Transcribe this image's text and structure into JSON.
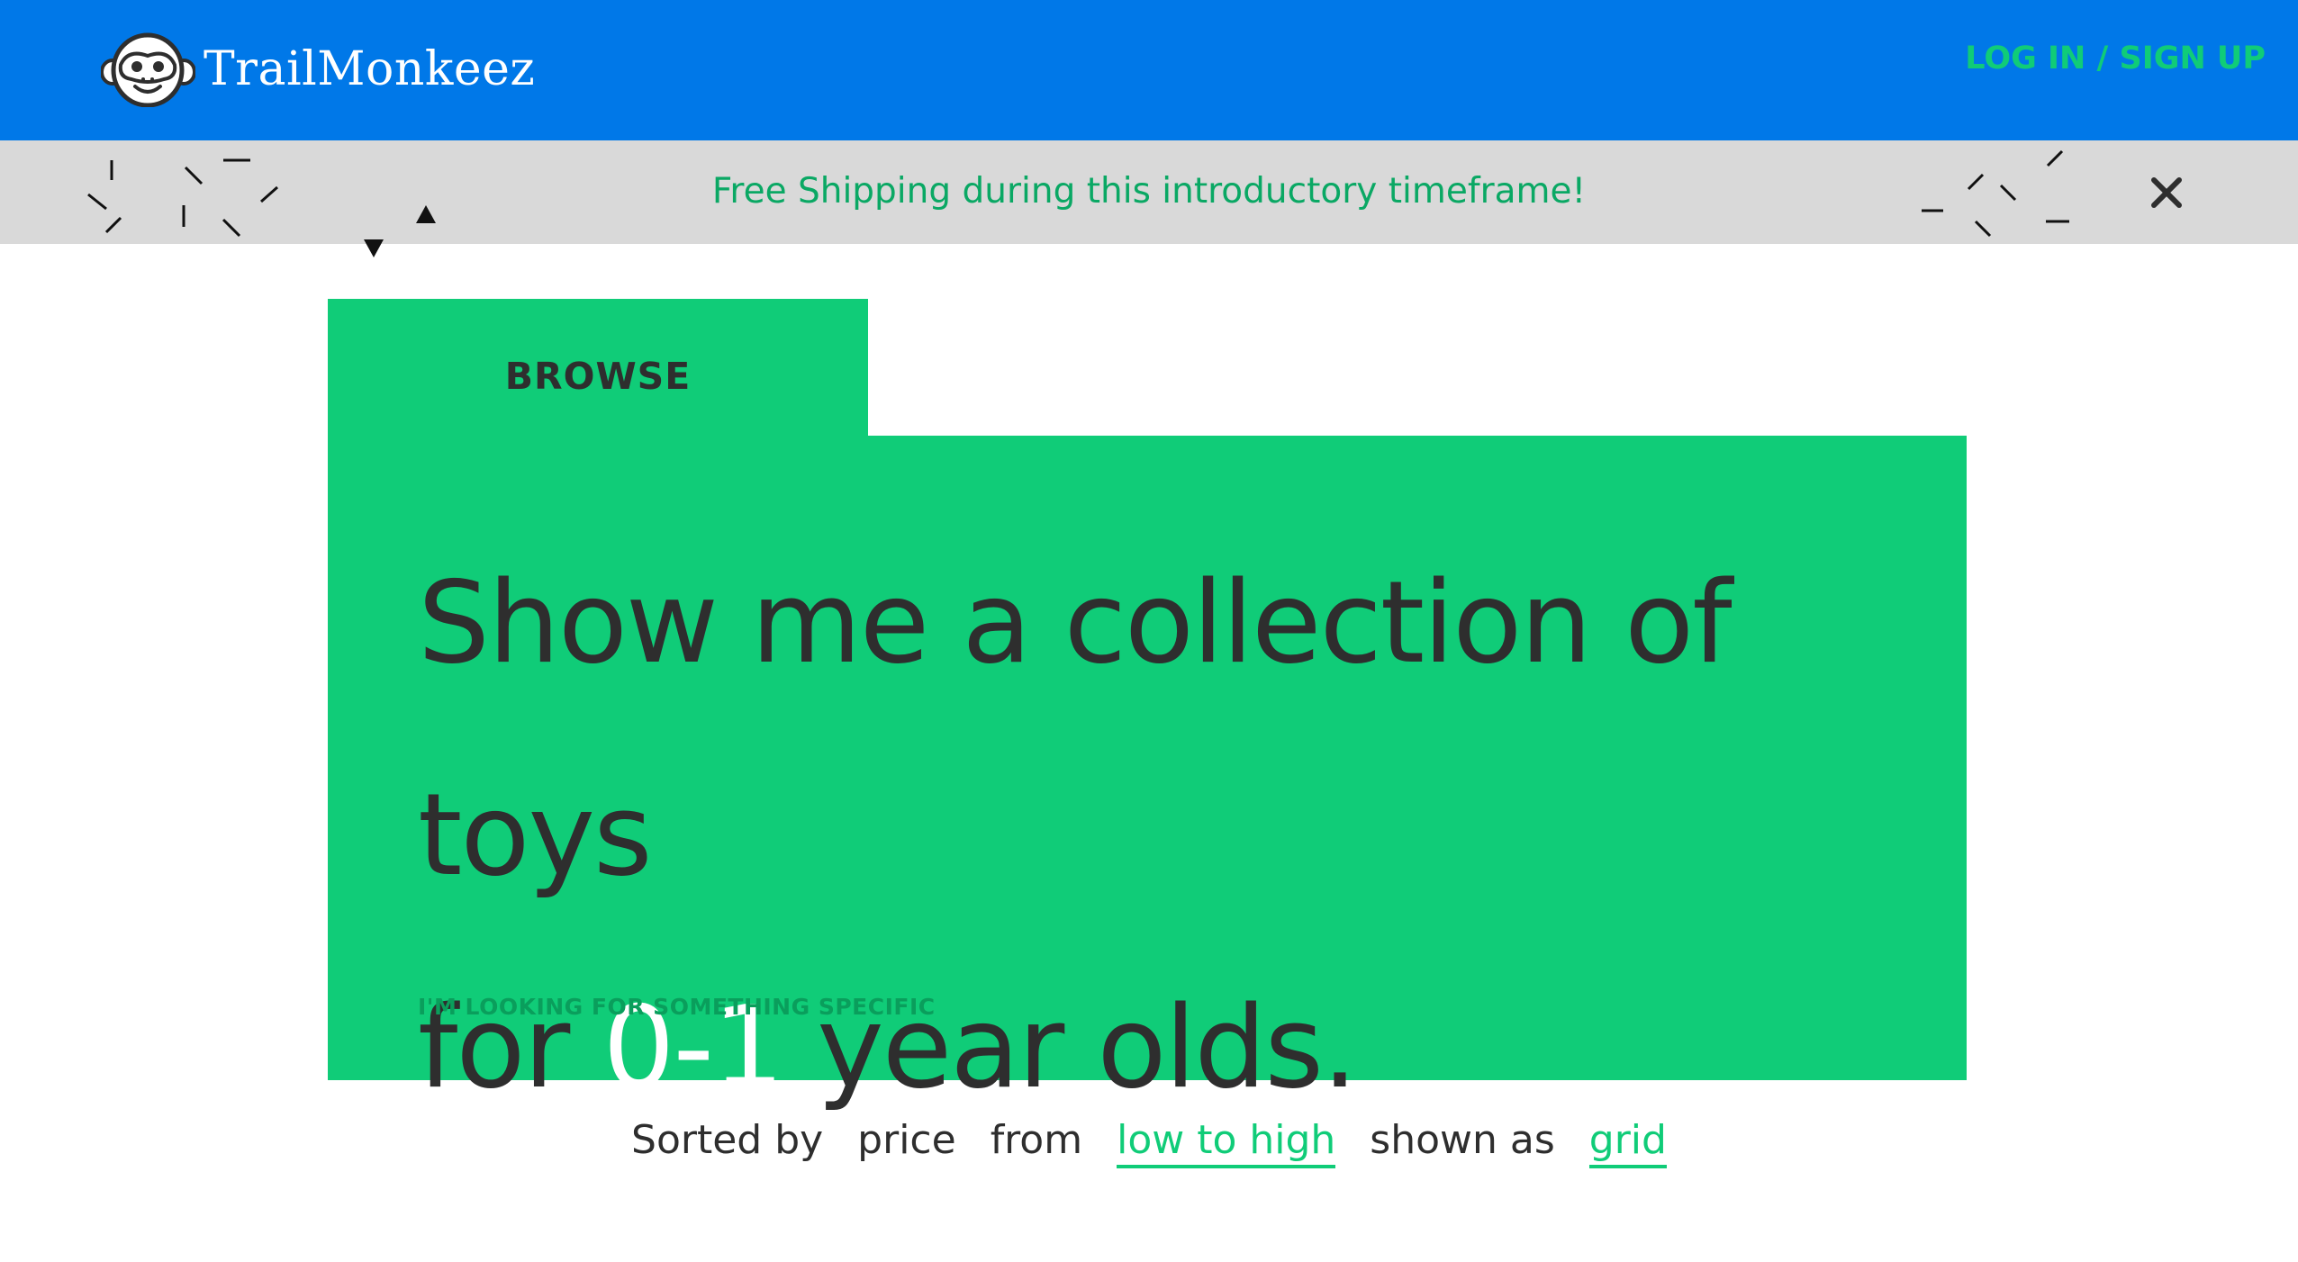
{
  "header": {
    "brand": "TrailMonkeez",
    "login_label": "LOG IN / SIGN UP",
    "logo_icon": "monkey-face-icon"
  },
  "promo": {
    "text": "Free Shipping during this introductory timeframe!",
    "close_icon": "close-icon"
  },
  "browse": {
    "tab_label": "BROWSE",
    "headline_part1": "Show me a collection of toys",
    "headline_part2_pre": "for",
    "age_value": "0-1",
    "headline_part2_post": "year olds.",
    "specific_link": "I'M LOOKING FOR SOMETHING SPECIFIC"
  },
  "sort": {
    "sorted_by_label": "Sorted by",
    "sort_field": "price",
    "from_label": "from",
    "order_value": "low to high",
    "shown_as_label": "shown as",
    "view_value": "grid"
  },
  "colors": {
    "header_blue": "#0078e8",
    "accent_green": "#10cc78",
    "promo_gray": "#d9d9d9",
    "text_dark": "#2e2e2e"
  }
}
